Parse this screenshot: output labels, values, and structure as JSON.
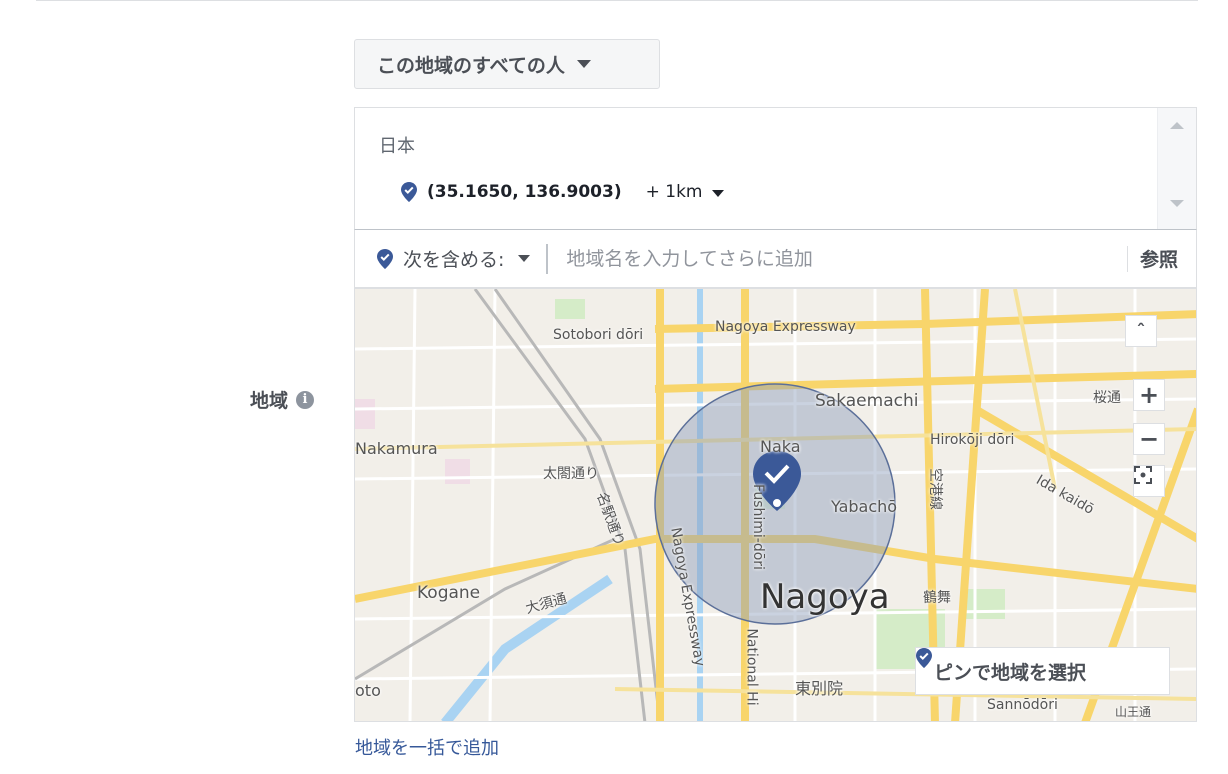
{
  "section": {
    "label": "地域"
  },
  "audience_dropdown": {
    "label": "この地域のすべての人"
  },
  "location_list": {
    "country": "日本",
    "selected": {
      "coords": "(35.1650, 136.9003)",
      "radius": "+ 1km"
    }
  },
  "include_bar": {
    "mode_label": "次を含める:",
    "placeholder": "地域名を入力してさらに追加",
    "browse_label": "参照"
  },
  "map": {
    "labels": {
      "sotobori": "Sotobori dōri",
      "expressway": "Nagoya Expressway",
      "sakaemachi": "Sakaemachi",
      "nakamura": "Nakamura",
      "naka": "Naka",
      "hirokoji": "Hirokōji dōri",
      "taiko": "太閤通り",
      "yabacho": "Yabachō",
      "ida": "Ida kaidō",
      "nagoya": "Nagoya",
      "kogane": "Kogane",
      "osu": "大須通",
      "tsurumai": "鶴舞",
      "higashibetsuin": "東別院",
      "sannodori": "Sannōdōri",
      "sanno": "山王通",
      "oto": "oto",
      "fushimi": "Fushimi-dōri",
      "nagoya_exp_v": "Nagoya Expressway",
      "national": "National Hi",
      "kuukou": "空港線",
      "meieki": "名駅通り",
      "sakura": "桜通"
    },
    "zoom_in": "+",
    "zoom_out": "−",
    "collapse": "ˆ",
    "pin_select_label": "ピンで地域を選択"
  },
  "bulk_add_link": "地域を一括で追加",
  "colors": {
    "pin": "#3b5998",
    "link": "#365899",
    "radius_fill": "#8a9bbb"
  }
}
